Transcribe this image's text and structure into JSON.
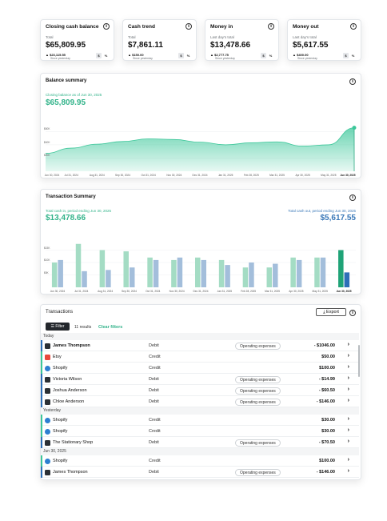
{
  "kpis": [
    {
      "title": "Closing cash balance",
      "sub": "Total",
      "value": "$65,809.95",
      "delta": "$23,115.55",
      "since": "Since yesterday"
    },
    {
      "title": "Cash trend",
      "sub": "Total",
      "value": "$7,861.11",
      "delta": "$150.00",
      "since": "Since yesterday"
    },
    {
      "title": "Money in",
      "sub": "Last day's total",
      "value": "$13,478.66",
      "delta": "$2,777.75",
      "since": "Since yesterday"
    },
    {
      "title": "Money out",
      "sub": "Last day's total",
      "value": "$5,617.55",
      "delta": "$400.00",
      "since": "Since yesterday"
    }
  ],
  "toggle": {
    "dollar": "$",
    "percent": "%"
  },
  "balance_summary": {
    "title": "Balance summary",
    "label": "Closing balance as of Jun 30, 2025",
    "value": "$65,809.95"
  },
  "transaction_summary": {
    "title": "Transaction Summary",
    "in_label": "Total cash in, period ending Jun 30, 2025",
    "in_value": "$13,478.66",
    "out_label": "Total cash out, period ending Jun 30, 2025",
    "out_value": "$5,617.55"
  },
  "chart_data": [
    {
      "type": "area",
      "x": [
        "Jun 30, 2024",
        "Jul 31, 2024",
        "Aug 31, 2024",
        "Sep 30, 2024",
        "Oct 31, 2024",
        "Nov 30, 2024",
        "Dec 31, 2024",
        "Jan 31, 2025",
        "Feb 28, 2025",
        "Mar 31, 2025",
        "Apr 30, 2025",
        "May 31, 2025",
        "Jun 30, 2025"
      ],
      "values": [
        27000,
        35000,
        41000,
        45000,
        49000,
        48000,
        44000,
        40000,
        43000,
        44500,
        38000,
        40000,
        65809.95
      ],
      "yticks": [
        "$60K",
        "$40K",
        "$20K"
      ],
      "ylim": [
        0,
        75000
      ],
      "color": "#3cc79a"
    },
    {
      "type": "bar",
      "categories": [
        "Jun 30, 2024",
        "Jul 31, 2024",
        "Aug 31, 2024",
        "Sep 30, 2024",
        "Oct 31, 2024",
        "Nov 30, 2024",
        "Dec 31, 2024",
        "Jan 31, 2025",
        "Feb 28, 2025",
        "Mar 31, 2025",
        "Apr 30, 2025",
        "May 31, 2025",
        "Jun 30, 2025"
      ],
      "series": [
        {
          "values": [
            10000,
            17500,
            15000,
            14500,
            12000,
            11000,
            12000,
            11000,
            8000,
            8000,
            12000,
            12000,
            15000
          ],
          "color": "#a4dcc4"
        },
        {
          "values": [
            11000,
            6500,
            7000,
            8000,
            11000,
            12000,
            11000,
            9000,
            10000,
            9500,
            11000,
            12000,
            6000
          ],
          "color": "#a3bedb"
        }
      ],
      "yticks": [
        "$15K",
        "$10K",
        "$5K"
      ],
      "ylim": [
        0,
        20000
      ]
    }
  ],
  "transactions": {
    "title": "Transactions",
    "export_label": "Export",
    "filter_label": "Filter",
    "results": "11 results",
    "clear_filters": "Clear filters",
    "groups": [
      {
        "label": "Today",
        "rows": [
          {
            "name": "James Thompson",
            "bold": true,
            "type": "Debit",
            "tag": "Operating expenses",
            "amount": "- $1046.00",
            "icon": "person-icon",
            "accent": "#2d6fb8"
          },
          {
            "name": "Etsy",
            "bold": false,
            "type": "Credit",
            "tag": "",
            "amount": "$50.00",
            "icon": "etsy-logo-icon",
            "accent": "#3cc79a"
          },
          {
            "name": "Shopify",
            "bold": false,
            "type": "Credit",
            "tag": "",
            "amount": "$100.00",
            "icon": "shopify-logo-icon",
            "accent": "#3cc79a"
          },
          {
            "name": "Victoria Wilson",
            "bold": false,
            "type": "Debit",
            "tag": "Operating expenses",
            "amount": "- $14.99",
            "icon": "person-icon",
            "accent": "#2d6fb8"
          },
          {
            "name": "Joshua Anderson",
            "bold": false,
            "type": "Debit",
            "tag": "Operating expenses",
            "amount": "- $60.50",
            "icon": "person-icon",
            "accent": "#2d6fb8"
          },
          {
            "name": "Chloe Anderson",
            "bold": false,
            "type": "Debit",
            "tag": "Operating expenses",
            "amount": "- $146.00",
            "icon": "person-icon",
            "accent": "#2d6fb8"
          }
        ]
      },
      {
        "label": "Yesterday",
        "rows": [
          {
            "name": "Shopify",
            "bold": false,
            "type": "Credit",
            "tag": "",
            "amount": "$30.00",
            "icon": "shopify-logo-icon",
            "accent": "#3cc79a"
          },
          {
            "name": "Shopify",
            "bold": false,
            "type": "Credit",
            "tag": "",
            "amount": "$30.00",
            "icon": "shopify-logo-icon",
            "accent": "#3cc79a"
          },
          {
            "name": "The Stationary Shop",
            "bold": false,
            "type": "Debit",
            "tag": "Operating expenses",
            "amount": "- $70.50",
            "icon": "store-icon",
            "accent": "#2d6fb8"
          }
        ]
      },
      {
        "label": "Jun 30, 2025",
        "rows": [
          {
            "name": "Shopify",
            "bold": false,
            "type": "Credit",
            "tag": "",
            "amount": "$100.00",
            "icon": "shopify-logo-icon",
            "accent": "#3cc79a"
          },
          {
            "name": "James Thompson",
            "bold": false,
            "type": "Debit",
            "tag": "Operating expenses",
            "amount": "- $146.00",
            "icon": "person-icon",
            "accent": "#2d6fb8"
          }
        ]
      }
    ]
  }
}
